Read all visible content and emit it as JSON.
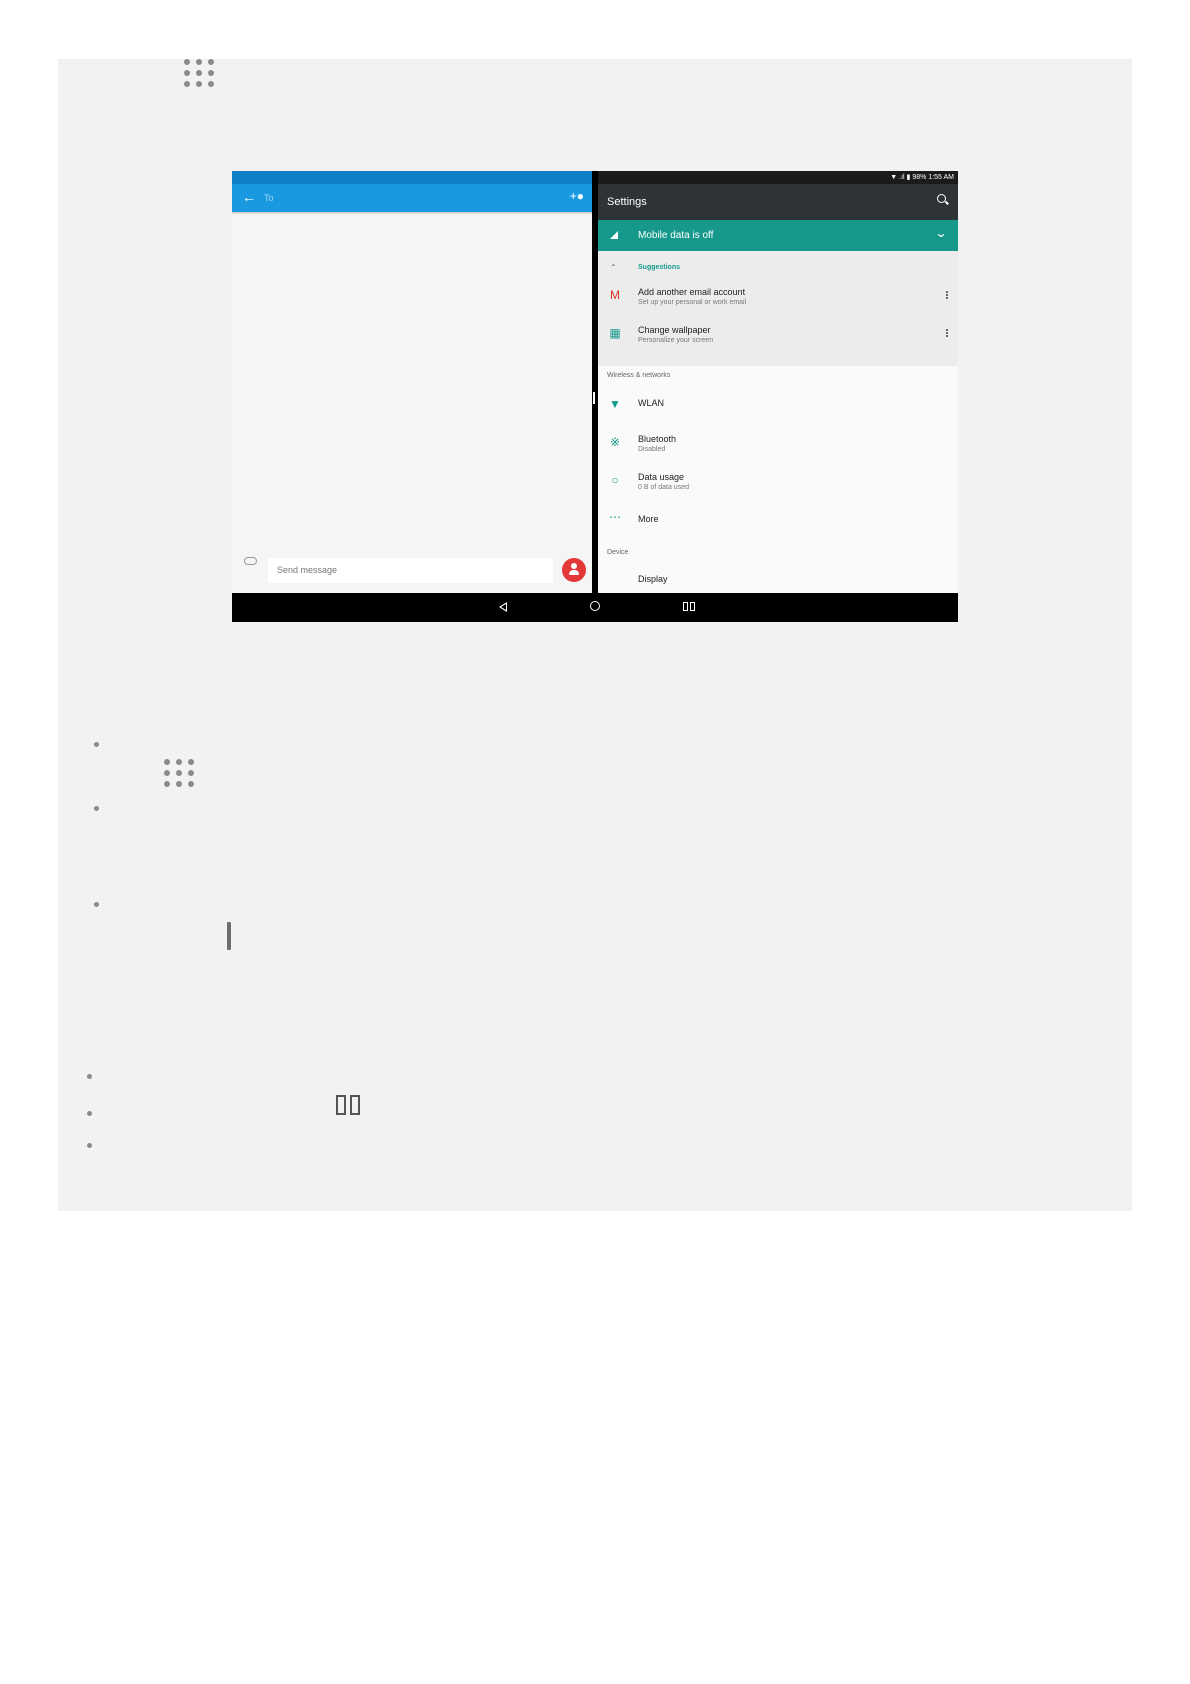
{
  "screenshot": {
    "left_app": {
      "to_placeholder": "To",
      "message_placeholder": "Send message"
    },
    "right_app": {
      "status_bar": "▼ .ıl ▮ 98%  1:55 AM",
      "title": "Settings",
      "banner": "Mobile data is off",
      "suggestions_header": "Suggestions",
      "suggestions": [
        {
          "title": "Add another email account",
          "subtitle": "Set up your personal or work email"
        },
        {
          "title": "Change wallpaper",
          "subtitle": "Personalize your screen"
        }
      ],
      "section_wireless": "Wireless & networks",
      "items": [
        {
          "title": "WLAN",
          "subtitle": ""
        },
        {
          "title": "Bluetooth",
          "subtitle": "Disabled"
        },
        {
          "title": "Data usage",
          "subtitle": "0 B of data used"
        },
        {
          "title": "More",
          "subtitle": ""
        }
      ],
      "section_device": "Device",
      "cut_item": "Display"
    }
  },
  "icons": {
    "apps_icon": "apps-grid-icon",
    "divider_icon": "divider-bar-icon",
    "recents_icon": "split-screen-icon"
  },
  "colors": {
    "panel": "#f2f2f2",
    "blue_toolbar": "#199ae0",
    "teal": "#16998a",
    "settings_toolbar": "#2d3337",
    "fab": "#e2383a"
  }
}
